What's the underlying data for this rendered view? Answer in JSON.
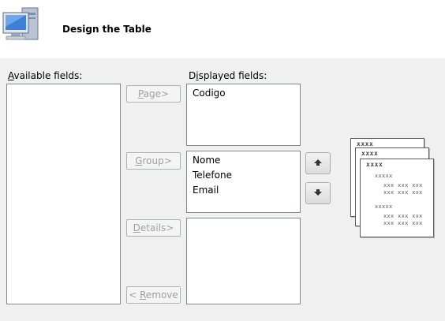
{
  "header": {
    "title": "Design the Table"
  },
  "available_fields": {
    "label_underline": "A",
    "label_rest": "vailable fields:",
    "items": []
  },
  "displayed_fields": {
    "label_first": "D",
    "label_underline": "i",
    "label_rest": "splayed fields:",
    "page_items": [
      "Codigo"
    ],
    "group_items": [
      "Nome",
      "Telefone",
      "Email"
    ],
    "detail_items": []
  },
  "buttons": {
    "page": {
      "underline": "P",
      "rest": "age>"
    },
    "group": {
      "underline": "G",
      "rest": "roup>"
    },
    "details": {
      "underline": "D",
      "rest": "etails>"
    },
    "remove": {
      "prefix": "< ",
      "underline": "R",
      "rest": "emove"
    }
  },
  "icons": {
    "wizard": "computer-monitor-icon",
    "move_up": "arrow-up-icon",
    "move_down": "arrow-down-icon"
  },
  "preview": {
    "header_text": "xxxx",
    "group_text": "xxxxx",
    "detail_text": "xxx xxx xxx"
  }
}
